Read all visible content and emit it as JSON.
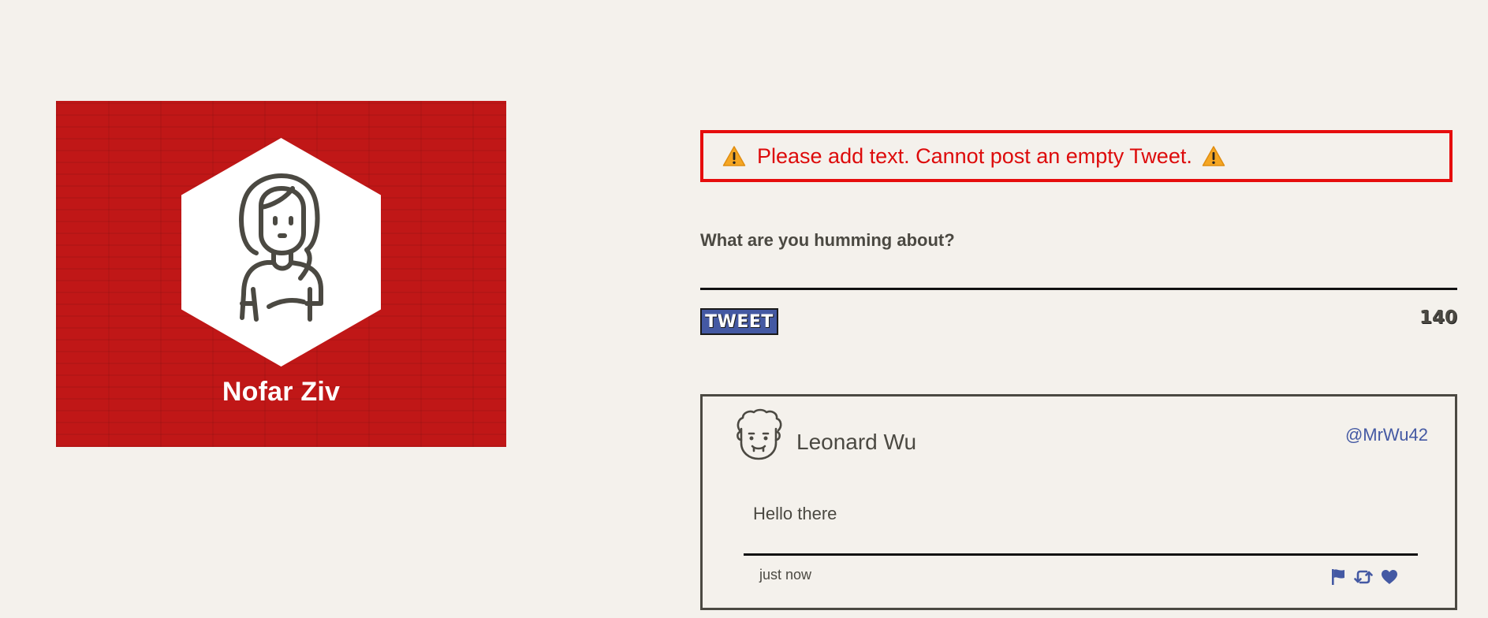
{
  "profile": {
    "name": "Nofar Ziv",
    "avatar_icon": "woman-avatar-icon",
    "card_color": "#c01717"
  },
  "error": {
    "message": "Please add text. Cannot post an empty Tweet.",
    "icon": "warning-icon",
    "color": "#dd0b0b"
  },
  "compose": {
    "label": "What are you humming about?",
    "value": "",
    "button_label": "TWEET",
    "char_count": "140"
  },
  "tweets": [
    {
      "author": "Leonard Wu",
      "handle": "@MrWu42",
      "avatar_icon": "man-avatar-icon",
      "text": "Hello there",
      "time": "just now",
      "actions": [
        "flag-icon",
        "retweet-icon",
        "heart-icon"
      ]
    }
  ],
  "colors": {
    "background": "#f4f1ec",
    "accent": "#4459a3",
    "text": "#4b4942"
  }
}
